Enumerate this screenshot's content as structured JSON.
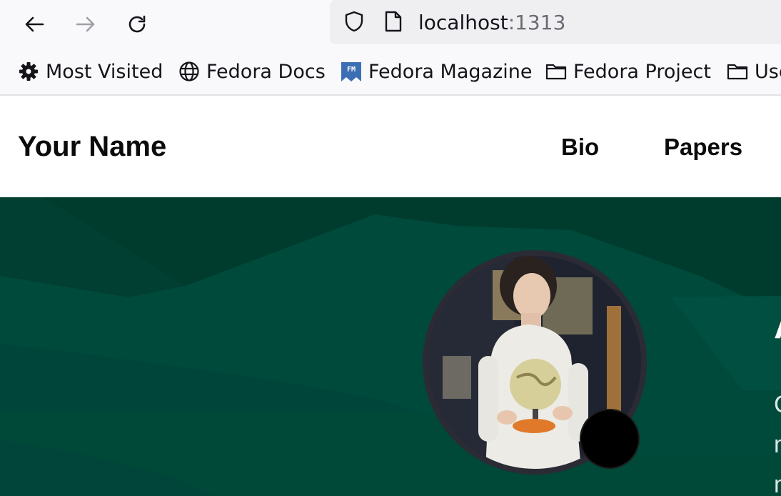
{
  "browser": {
    "url_host": "localhost",
    "url_port": ":1313",
    "bookmarks": [
      {
        "label": "Most Visited",
        "icon": "gear-icon"
      },
      {
        "label": "Fedora Docs",
        "icon": "globe-icon"
      },
      {
        "label": "Fedora Magazine",
        "icon": "fedora-magazine-icon"
      },
      {
        "label": "Fedora Project",
        "icon": "folder-icon"
      },
      {
        "label": "Use",
        "icon": "folder-icon"
      }
    ]
  },
  "site": {
    "brand": "Your Name",
    "menu": [
      "Bio",
      "Papers"
    ]
  },
  "hero": {
    "heading": "A",
    "text_lines": [
      "C",
      "n",
      "n"
    ],
    "status_emoji": "☕",
    "colors": {
      "background": "#00493a",
      "dark": "#003a2c"
    }
  }
}
